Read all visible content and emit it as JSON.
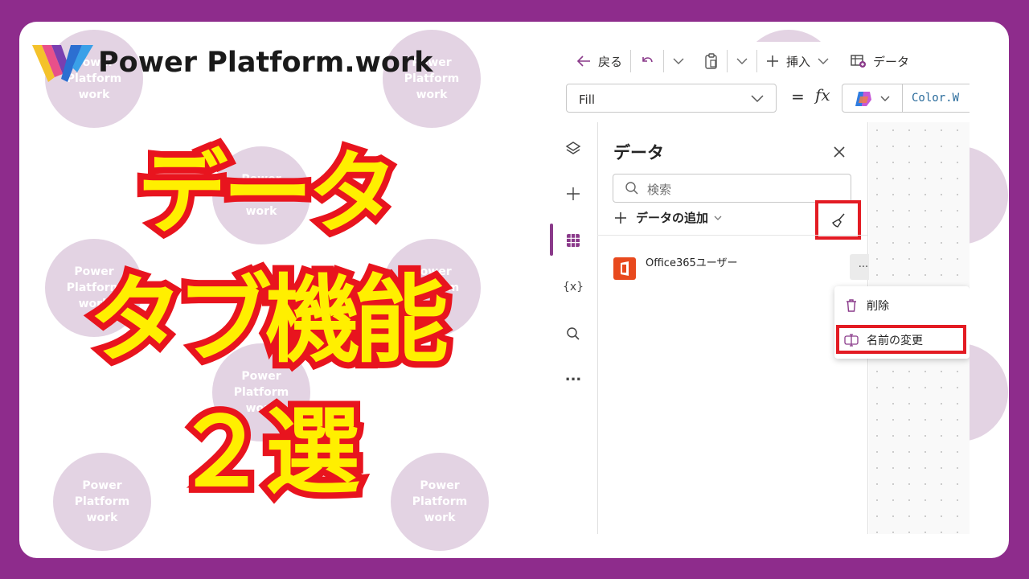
{
  "brand": {
    "name": "Power Platform.work",
    "watermark_text": [
      "Power",
      "Platform",
      "work"
    ]
  },
  "title": {
    "line1": "データ",
    "line2": "タブ機能",
    "line3": "２選"
  },
  "colors": {
    "frame": "#8e2c8c",
    "title_fill": "#ffef00",
    "title_outline": "#e8141e",
    "highlight": "#e31b23",
    "accent": "#8a3a8a"
  },
  "toolbar": {
    "back_label": "戻る",
    "insert_label": "挿入",
    "data_label": "データ"
  },
  "formula": {
    "property": "Fill",
    "equals": "=",
    "fx": "fx",
    "value": "Color.W"
  },
  "rail": {
    "icons": [
      "layers-icon",
      "plus-icon",
      "grid-icon",
      "variables-icon",
      "search-icon",
      "more-icon"
    ],
    "variables_label": "{x}",
    "more_label": "..."
  },
  "panel": {
    "title": "データ",
    "search_placeholder": "検索",
    "add_data_label": "データの追加",
    "source_name": "Office365ユーザー",
    "more_label": "..."
  },
  "context_menu": {
    "delete_label": "削除",
    "rename_label": "名前の変更"
  }
}
